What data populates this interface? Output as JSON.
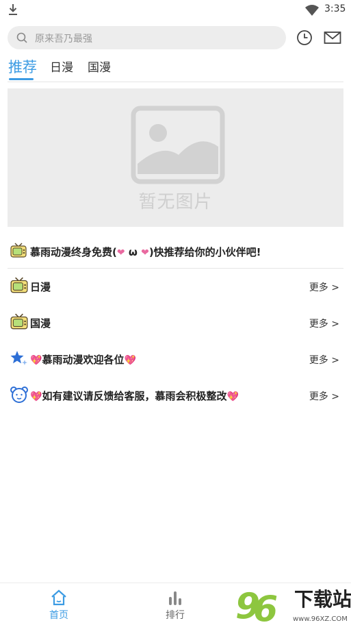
{
  "status_bar": {
    "time": "3:35"
  },
  "search": {
    "placeholder": "原来吾乃最强"
  },
  "tabs": [
    {
      "label": "推荐",
      "active": true
    },
    {
      "label": "日漫",
      "active": false
    },
    {
      "label": "国漫",
      "active": false
    }
  ],
  "banner": {
    "placeholder_text": "暂无图片"
  },
  "notice": {
    "text_before": "慕雨动漫终身免费(",
    "text_middle": " ω ",
    "text_after": ")快推荐给你的小伙伴吧!"
  },
  "sections": [
    {
      "title": "日漫",
      "more": "更多 >"
    },
    {
      "title": "国漫",
      "more": "更多 >"
    },
    {
      "title": "慕雨动漫欢迎各位",
      "more": "更多 >"
    },
    {
      "title": "如有建议请反馈给客服，慕雨会积极整改",
      "more": "更多 >"
    }
  ],
  "bottom_nav": [
    {
      "label": "首页",
      "active": true
    },
    {
      "label": "排行",
      "active": false
    }
  ],
  "watermark": {
    "text": "下载站",
    "url": "www.96XZ.COM"
  },
  "colors": {
    "accent": "#3b9be3",
    "heart": "#e96aa0"
  }
}
